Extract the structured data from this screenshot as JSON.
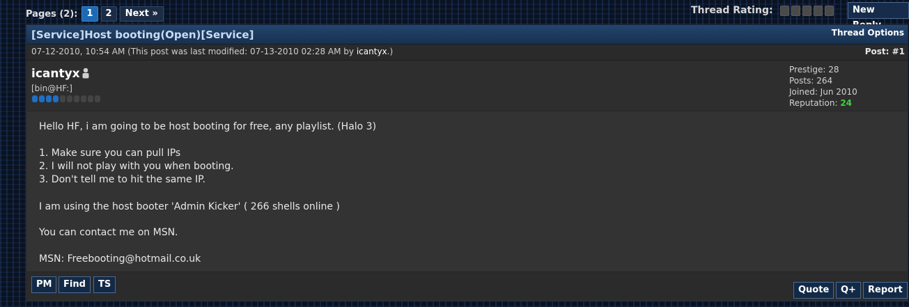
{
  "pagination": {
    "label": "Pages (2):",
    "pages": [
      "1",
      "2"
    ],
    "next": "Next »"
  },
  "rating": {
    "label": "Thread Rating:",
    "stars_filled": 0,
    "stars_total": 5
  },
  "new_reply": "New Reply",
  "thread": {
    "title": "[Service]Host booting(Open)[Service]",
    "options": "Thread Options"
  },
  "post": {
    "date_prefix": "07-12-2010, 10:54 AM (This post was last modified: 07-13-2010 02:28 AM by ",
    "modified_by": "icantyx",
    "date_suffix": ".)",
    "number": "Post: #1",
    "author": {
      "username": "icantyx",
      "title": "[bin@HF:]",
      "reputation_level": 4,
      "reputation_total": 10,
      "status_icon": "offline-user-icon"
    },
    "stats": {
      "prestige": "Prestige: 28",
      "posts": "Posts: 264",
      "joined": "Joined: Jun 2010",
      "reputation_label": "Reputation: ",
      "reputation_value": "24"
    },
    "body": [
      "Hello HF, i am going to be host booting for free, any playlist. (Halo 3)",
      "1. Make sure you can pull IPs",
      "2. I will not play with you when booting.",
      "3. Don't tell me to hit the same IP.",
      "I am using the host booter 'Admin Kicker' ( 266 shells online )",
      "You can contact me on MSN.",
      "MSN: Freebooting@hotmail.co.uk"
    ],
    "buttons_left": [
      "PM",
      "Find",
      "TS"
    ],
    "buttons_right": [
      "Quote",
      "Q+",
      "Report"
    ]
  },
  "colors": {
    "header": "#17304f",
    "current_page": "#1c6ab6",
    "reputation_positive": "#3fcf3f",
    "rep_bar_on": "#1f6fc2"
  }
}
